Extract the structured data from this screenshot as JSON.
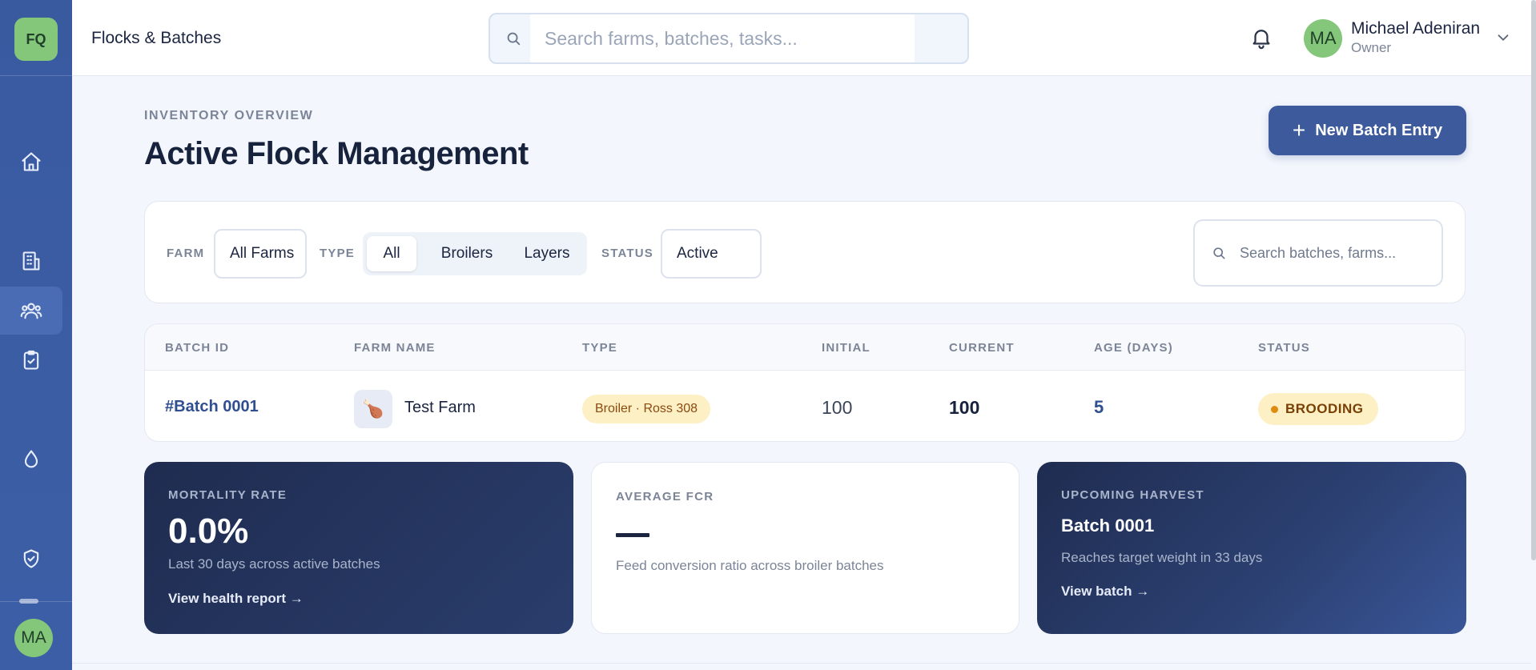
{
  "brand": {
    "initials": "FQ"
  },
  "sidebar": {
    "items": [
      {
        "name": "home-icon"
      },
      {
        "name": "building-icon"
      },
      {
        "name": "users-icon",
        "active": true
      },
      {
        "name": "clipboard-check-icon"
      },
      {
        "name": "droplet-icon"
      },
      {
        "name": "shield-check-icon"
      }
    ],
    "avatar_initials": "MA"
  },
  "header": {
    "page_label": "Flocks & Batches",
    "search_placeholder": "Search farms, batches, tasks...",
    "user": {
      "initials": "MA",
      "name": "Michael Adeniran",
      "role": "Owner"
    }
  },
  "main": {
    "eyebrow": "INVENTORY OVERVIEW",
    "title": "Active Flock Management",
    "new_batch_label": "New Batch Entry",
    "new_batch_plus": "+"
  },
  "filters": {
    "farm_label": "FARM",
    "farm_value": "All Farms",
    "type_label": "TYPE",
    "type_options": [
      "All",
      "Broilers",
      "Layers"
    ],
    "type_selected": "All",
    "status_label": "STATUS",
    "status_value": "Active",
    "search_placeholder": "Search batches, farms..."
  },
  "table": {
    "columns": [
      "BATCH ID",
      "FARM NAME",
      "TYPE",
      "INITIAL",
      "CURRENT",
      "AGE (DAYS)",
      "STATUS"
    ],
    "rows": [
      {
        "batch_id": "#Batch 0001",
        "farm_icon": "🍗",
        "farm_name": "Test Farm",
        "type": "Broiler · Ross 308",
        "initial": "100",
        "current": "100",
        "age": "5",
        "status": "BROODING"
      }
    ]
  },
  "cards": {
    "mortality": {
      "eyebrow": "MORTALITY RATE",
      "value": "0.0%",
      "sub": "Last 30 days across active batches",
      "link": "View health report →"
    },
    "fcr": {
      "eyebrow": "AVERAGE FCR",
      "sub": "Feed conversion ratio across broiler batches"
    },
    "harvest": {
      "eyebrow": "UPCOMING HARVEST",
      "title": "Batch 0001",
      "sub": "Reaches target weight in 33 days",
      "link": "View batch →"
    }
  },
  "colors": {
    "sidebar": "#3b5ca3",
    "accent": "#3c5a9c",
    "avatar": "#84c77b",
    "badge_bg": "#fdf0c4",
    "badge_text": "#8a4a10",
    "status_dot": "#e08a10"
  }
}
